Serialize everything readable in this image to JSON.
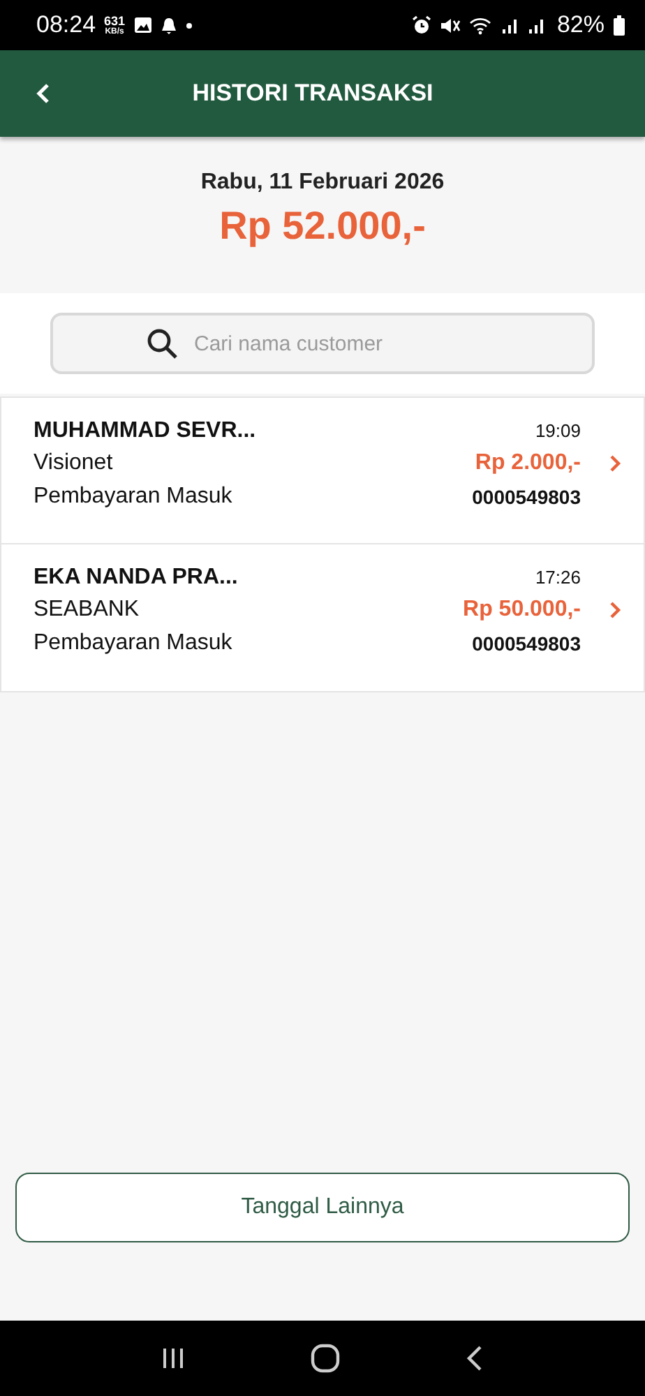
{
  "status_bar": {
    "time": "08:24",
    "speed_value": "631",
    "speed_unit": "KB/s",
    "battery": "82%"
  },
  "header": {
    "title": "HISTORI TRANSAKSI"
  },
  "summary": {
    "date": "Rabu, 11 Februari 2026",
    "total": "Rp 52.000,-"
  },
  "search": {
    "placeholder": "Cari nama customer"
  },
  "transactions": [
    {
      "name": "MUHAMMAD SEVR...",
      "bank": "Visionet",
      "type": "Pembayaran Masuk",
      "time": "19:09",
      "amount": "Rp 2.000,-",
      "reference": "0000549803"
    },
    {
      "name": "EKA NANDA PRA...",
      "bank": "SEABANK",
      "type": "Pembayaran Masuk",
      "time": "17:26",
      "amount": "Rp 50.000,-",
      "reference": "0000549803"
    }
  ],
  "more_button": "Tanggal Lainnya"
}
